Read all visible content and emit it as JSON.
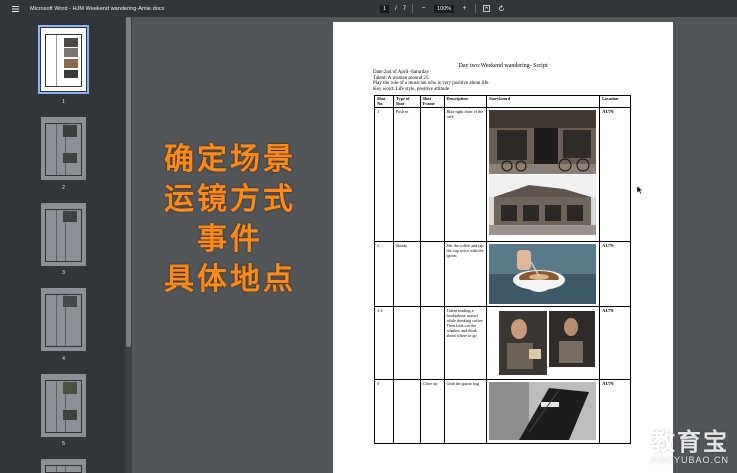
{
  "toolbar": {
    "title": "Microsoft Word - HJM Weekend wandering-Amie.docx",
    "page_current": "1",
    "page_sep": "/",
    "page_total": "7",
    "zoom": "100%",
    "zoom_out": "−",
    "zoom_in": "+"
  },
  "sidebar": {
    "thumbnails": [
      {
        "label": "1"
      },
      {
        "label": "2"
      },
      {
        "label": "3"
      },
      {
        "label": "4"
      },
      {
        "label": "5"
      }
    ]
  },
  "overlay": {
    "lines": [
      "确定场景",
      "运镜方式",
      "事件",
      "具体地点"
    ],
    "color": "#ff8a1c"
  },
  "document": {
    "title": "Day two:Weekend wandering- Script",
    "date_line": "Date:2nd of April -Saturday",
    "talent": "Talent: A woman around 25.",
    "role": "Play the role of a musician who is very positive about life.",
    "keyword": "Key word: Life style, positive attitude",
    "headers": [
      "Shot No.",
      "Type of Shot",
      "Shot Frame",
      "Description",
      "Storyboard",
      "Location"
    ],
    "rows": [
      {
        "no": "1",
        "type": "Push in",
        "frame": "",
        "desc": "Bike right front of the café",
        "loc": "AU79"
      },
      {
        "no": "2",
        "type": "Steady",
        "frame": "",
        "desc": "Stir the coffee and tap the cup twice with the spoon",
        "loc": "AU79"
      },
      {
        "no": "3-4",
        "type": "",
        "frame": "",
        "desc": "Talent reading a book(about music) while drinking coffee. Then look out the window and think about where to go",
        "loc": "AU79"
      },
      {
        "no": "5",
        "type": "",
        "frame": "Close up",
        "desc": "Grab the guitar bag",
        "loc": "AU79"
      }
    ]
  },
  "watermark": {
    "big": "教育宝",
    "small": "JIAOYUBAO.CN"
  }
}
